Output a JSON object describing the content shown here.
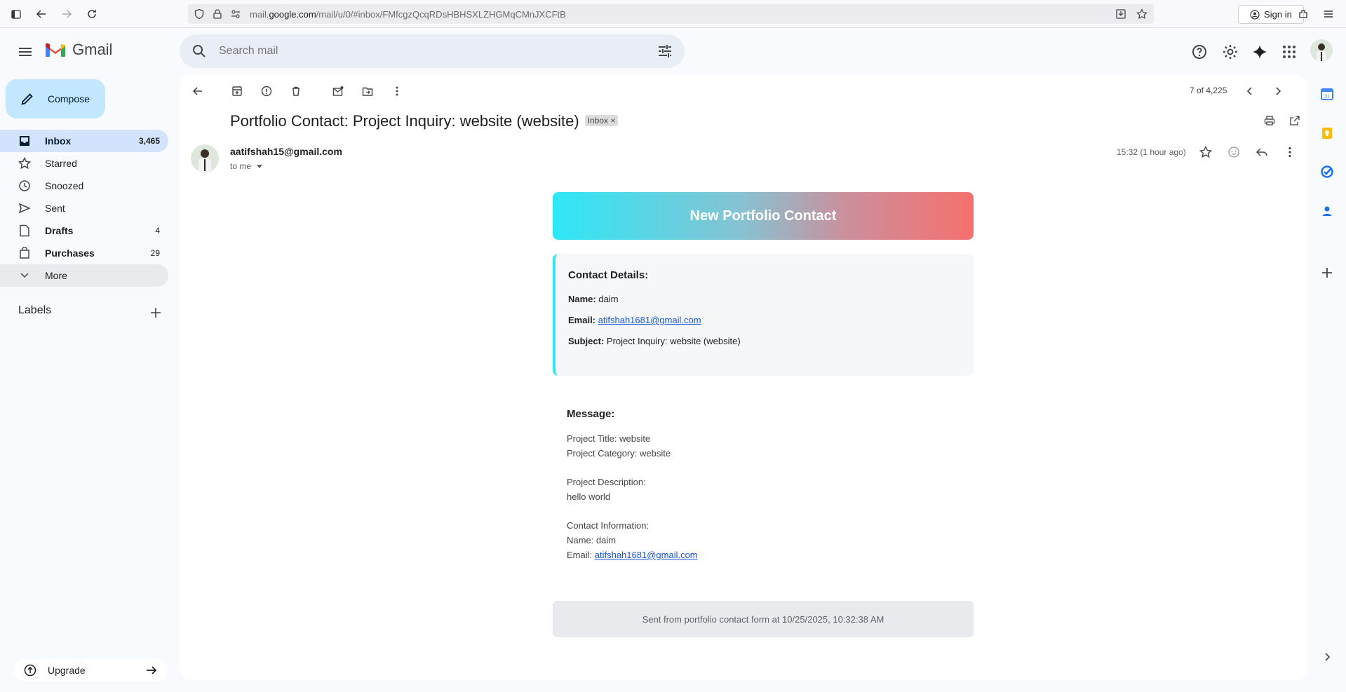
{
  "browser": {
    "url_host": "mail.google.com",
    "url_path": "/mail/u/0/#inbox/FMfcgzQcqRDsHBHSXLZHGMqCMnJXCFtB",
    "url_prefix": "mail.",
    "url_domain": "google.com",
    "signin_label": "Sign in"
  },
  "header": {
    "app_name": "Gmail",
    "search_placeholder": "Search mail"
  },
  "compose": {
    "label": "Compose"
  },
  "sidebar": {
    "items": [
      {
        "label": "Inbox",
        "count": "3,465"
      },
      {
        "label": "Starred",
        "count": ""
      },
      {
        "label": "Snoozed",
        "count": ""
      },
      {
        "label": "Sent",
        "count": ""
      },
      {
        "label": "Drafts",
        "count": "4"
      },
      {
        "label": "Purchases",
        "count": "29"
      },
      {
        "label": "More",
        "count": ""
      }
    ],
    "labels_heading": "Labels",
    "upgrade_label": "Upgrade"
  },
  "toolbar": {
    "pager": "7 of 4,225"
  },
  "email": {
    "subject": "Portfolio Contact: Project Inquiry: website (website)",
    "label_chip": "Inbox",
    "chip_close": "×",
    "sender": "aatifshah15@gmail.com",
    "recipient": "to me",
    "time": "15:32 (1 hour ago)",
    "banner": "New Portfolio Contact",
    "details_heading": "Contact Details:",
    "name_key": "Name:",
    "name_value": "daim",
    "email_key": "Email:",
    "email_value": "atifshah1681@gmail.com",
    "subject_key": "Subject:",
    "subject_value": "Project Inquiry: website (website)",
    "message_heading": "Message:",
    "msg_project_title": "Project Title: website",
    "msg_project_category": "Project Category: website",
    "msg_desc_heading": "Project Description:",
    "msg_desc": "hello world",
    "msg_contact_heading": "Contact Information:",
    "msg_name": "Name: daim",
    "msg_email_prefix": "Email:",
    "msg_email": "atifshah1681@gmail.com",
    "footer": "Sent from portfolio contact form at 10/25/2025, 10:32:38 AM"
  },
  "colors": {
    "accent_blue": "#1a56d8",
    "compose_bg": "#c2e7ff",
    "active_nav": "#d3e3fd",
    "banner_start": "#2ee7f6",
    "banner_end": "#f5706e"
  }
}
